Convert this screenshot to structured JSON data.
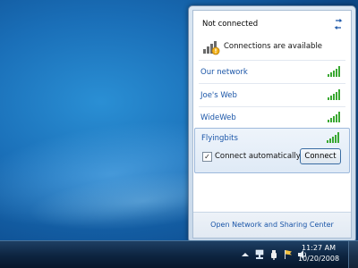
{
  "flyout": {
    "status_title": "Not connected",
    "availability_text": "Connections are available",
    "networks": [
      {
        "name": "Our network",
        "signal_bars": 5
      },
      {
        "name": "Joe's Web",
        "signal_bars": 5
      },
      {
        "name": "WideWeb",
        "signal_bars": 5
      }
    ],
    "selected_network": {
      "name": "Flyingbits",
      "signal_bars": 5,
      "connect_automatically_label": "Connect automatically",
      "connect_automatically_checked": true,
      "connect_button_label": "Connect"
    },
    "footer_link": "Open Network and Sharing Center"
  },
  "taskbar": {
    "tray_icons": [
      "show-hidden-icons-arrow",
      "network-icon",
      "power-icon",
      "action-center-flag-icon",
      "volume-icon"
    ],
    "time": "11:27 AM",
    "date": "10/20/2008"
  },
  "colors": {
    "link": "#1b56a8",
    "signal_green": "#3aa832"
  }
}
